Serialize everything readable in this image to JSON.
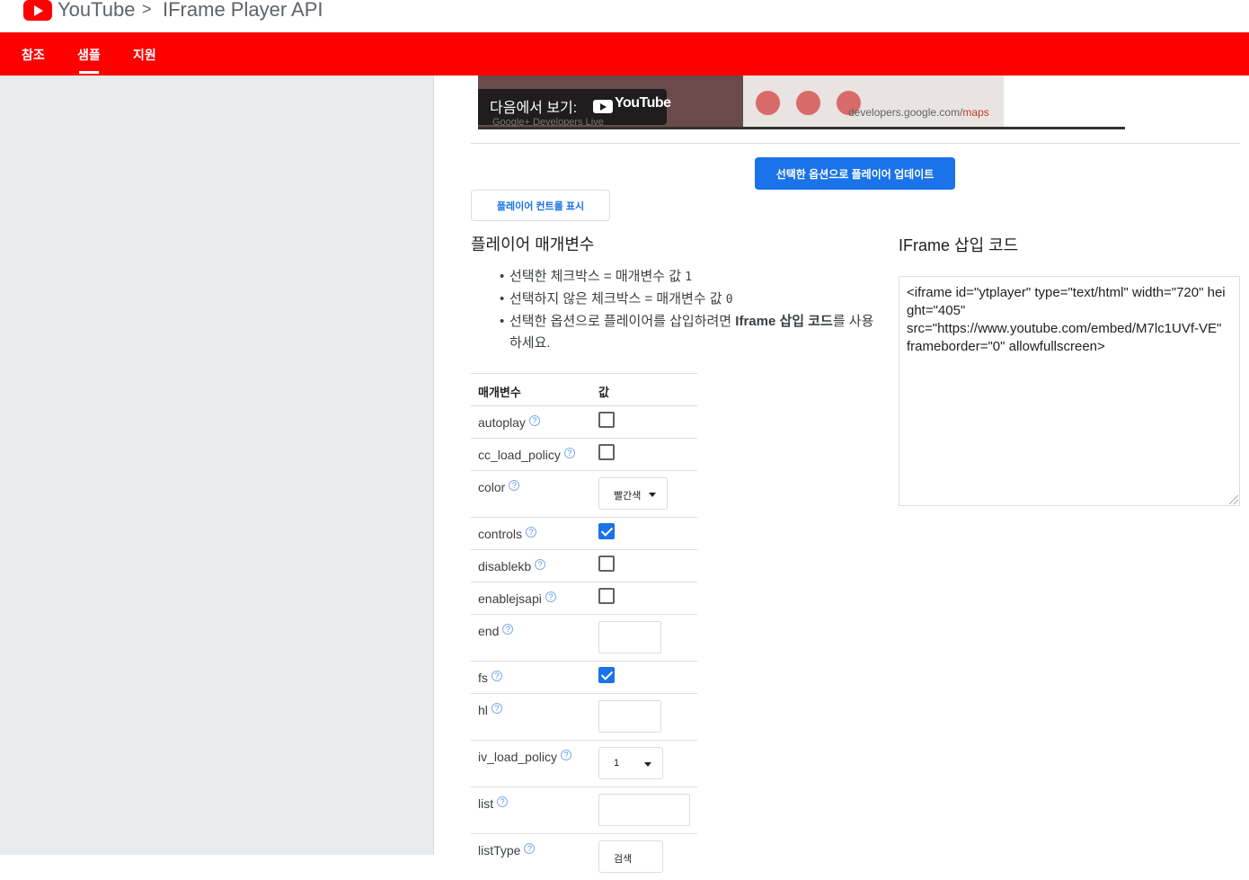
{
  "header": {
    "brand": "YouTube",
    "separator": ">",
    "page": "IFrame Player API"
  },
  "nav": {
    "tabs": [
      {
        "label": "참조",
        "active": false
      },
      {
        "label": "샘플",
        "active": true
      },
      {
        "label": "지원",
        "active": false
      }
    ]
  },
  "video": {
    "watch_on": "다음에서 보기:",
    "watch_brand": "YouTube",
    "channel_overlay": "Google+ Developers Live",
    "url_prefix": "developers.google.com/",
    "url_suffix": "maps"
  },
  "buttons": {
    "update": "선택한 옵션으로 플레이어 업데이트",
    "show_controls": "플레이어 컨트롤 표시"
  },
  "params_section": {
    "title": "플레이어 매개변수",
    "note1_text": "선택한 체크박스 = 매개변수 값 ",
    "note1_code": "1",
    "note2_text": "선택하지 않은 체크박스 = 매개변수 값 ",
    "note2_code": "0",
    "note3_pre": "선택한 옵션으로 플레이어를 삽입하려면 ",
    "note3_bold": "Iframe 삽입 코드",
    "note3_post": "를 사용하세요."
  },
  "table": {
    "col_param": "매개변수",
    "col_value": "값",
    "help_glyph": "?",
    "rows": [
      {
        "name": "autoplay",
        "type": "checkbox",
        "checked": false
      },
      {
        "name": "cc_load_policy",
        "type": "checkbox",
        "checked": false
      },
      {
        "name": "color",
        "type": "select",
        "value": "빨간색"
      },
      {
        "name": "controls",
        "type": "checkbox",
        "checked": true
      },
      {
        "name": "disablekb",
        "type": "checkbox",
        "checked": false
      },
      {
        "name": "enablejsapi",
        "type": "checkbox",
        "checked": false
      },
      {
        "name": "end",
        "type": "text",
        "value": ""
      },
      {
        "name": "fs",
        "type": "checkbox",
        "checked": true
      },
      {
        "name": "hl",
        "type": "text",
        "value": ""
      },
      {
        "name": "iv_load_policy",
        "type": "select",
        "value": "1"
      },
      {
        "name": "list",
        "type": "text",
        "value": ""
      },
      {
        "name": "listType",
        "type": "select",
        "value": "검색"
      }
    ]
  },
  "iframe_section": {
    "title": "IFrame 삽입 코드",
    "code": "<iframe id=\"ytplayer\" type=\"text/html\" width=\"720\" height=\"405\"\nsrc=\"https://www.youtube.com/embed/M7lc1UVf-VE\"\nframeborder=\"0\" allowfullscreen>"
  },
  "colors": {
    "brand_red": "#ff0000",
    "accent_blue": "#1a73e8",
    "sidebar_bg": "#e8eaed"
  }
}
